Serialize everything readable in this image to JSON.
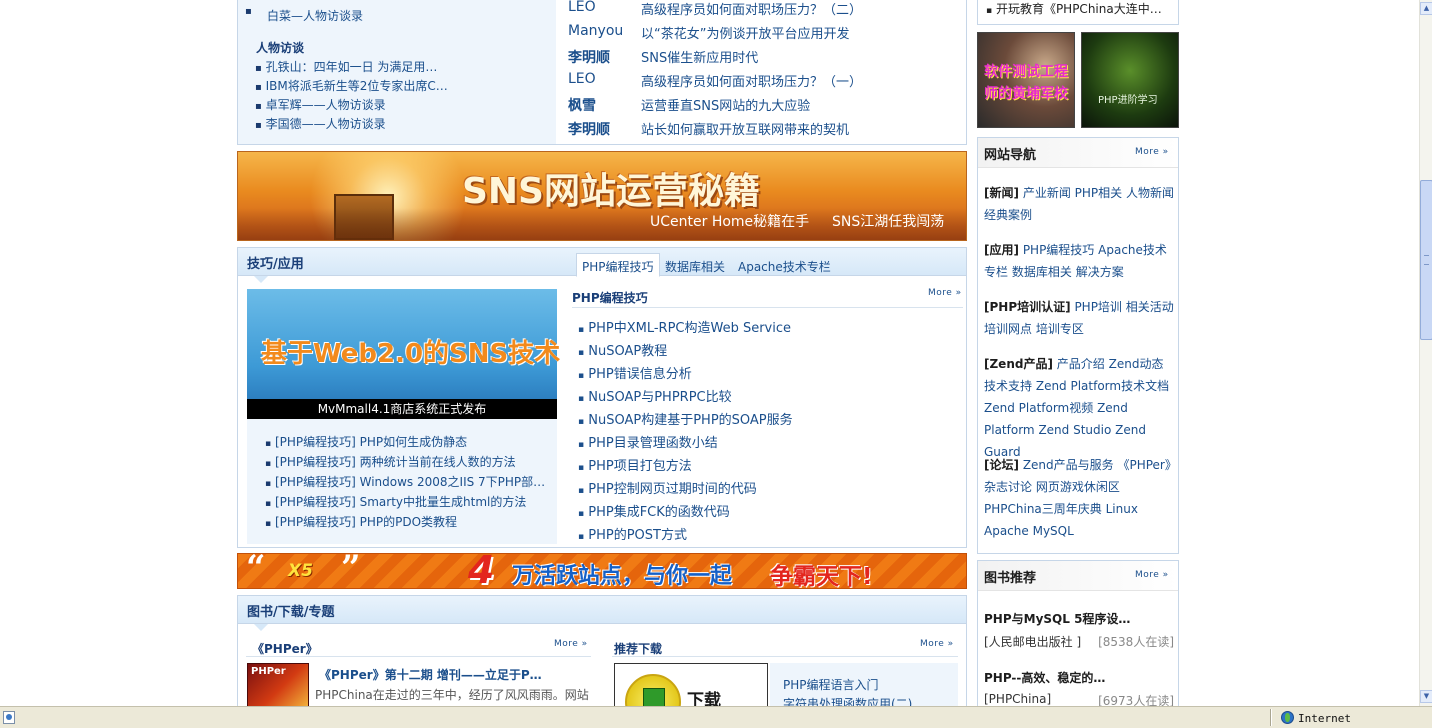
{
  "top_left": {
    "items_top": [
      "白菜—人物访谈录"
    ],
    "heading": "人物访谈",
    "items": [
      "孔铁山：四年如一日 为满足用…",
      "IBM将派毛新生等2位专家出席C…",
      "卓军辉——人物访谈录",
      "李国德——人物访谈录"
    ]
  },
  "top_mid": {
    "rows": [
      {
        "author": "LEO",
        "title": "高级程序员如何面对职场压力？（二）"
      },
      {
        "author": "Manyou",
        "title": "以“茶花女”为例谈开放平台应用开发"
      },
      {
        "author": "李明顺",
        "title": "SNS催生新应用时代"
      },
      {
        "author": "LEO",
        "title": "高级程序员如何面对职场压力？（一）"
      },
      {
        "author": "枫雪",
        "title": "运营垂直SNS网站的九大应验"
      },
      {
        "author": "李明顺",
        "title": "站长如何赢取开放互联网带来的契机"
      }
    ]
  },
  "banner_sns": {
    "title": "SNS网站运营秘籍",
    "sub1": "UCenter Home秘籍在手",
    "sub2": "SNS江湖任我闯荡"
  },
  "tips": {
    "title": "技巧/应用",
    "tabs": [
      "PHP编程技巧",
      "数据库相关",
      "Apache技术专栏"
    ],
    "feature_image_text": "基于Web2.0的SNS技术",
    "feature_caption": "MvMmall4.1商店系统正式发布",
    "left_list": [
      "[PHP编程技巧] PHP如何生成伪静态",
      "[PHP编程技巧] 两种统计当前在线人数的方法",
      "[PHP编程技巧] Windows 2008之IIS 7下PHP部…",
      "[PHP编程技巧] Smarty中批量生成html的方法",
      "[PHP编程技巧] PHP的PDO类教程"
    ],
    "list_title": "PHP编程技巧",
    "more": "More »",
    "right_list": [
      "PHP中XML-RPC构造Web Service",
      "NuSOAP教程",
      "PHP错误信息分析",
      "NuSOAP与PHPRPC比较",
      "NuSOAP构建基于PHP的SOAP服务",
      "PHP目录管理函数小结",
      "PHP项目打包方法",
      "PHP控制网页过期时间的代码",
      "PHP集成FCK的函数代码",
      "PHP的POST方式"
    ]
  },
  "banner_x5": {
    "logo": "X5",
    "number": "4",
    "text": "万活跃站点，与你一起",
    "emph": "争霸天下!"
  },
  "books_section": {
    "title": "图书/下载/专题",
    "phper_title": "《PHPer》",
    "more": "More »",
    "phper_item_title": "《PHPer》第十二期 增刊——立足于P…",
    "phper_item_desc": "PHPChina在走过的三年中，经历了风风雨雨。网站",
    "phper_cover_text": "PHPer",
    "download_title": "推荐下载",
    "download_btn": "下载",
    "download_items": [
      "PHP编程语言入门",
      "字符串处理函数应用(二)"
    ]
  },
  "sidebar": {
    "top_item": "开玩教育《PHPChina大连中…",
    "img1_text": "软件测试工程师的黄埔军校",
    "img2_text": "PHP进阶学习",
    "nav_title": "网站导航",
    "more": "More »",
    "nav_groups": [
      {
        "label": "[新闻]",
        "links": [
          "产业新闻",
          "PHP相关",
          "人物新闻",
          "经典案例"
        ]
      },
      {
        "label": "[应用]",
        "links": [
          "PHP编程技巧",
          "Apache技术专栏",
          "数据库相关",
          "解决方案"
        ]
      },
      {
        "label": "[PHP培训认证]",
        "links": [
          "PHP培训",
          "相关活动",
          "培训网点",
          "培训专区"
        ]
      },
      {
        "label": "[Zend产品]",
        "links": [
          "产品介绍",
          "Zend动态",
          "技术支持",
          "Zend Platform技术文档",
          "Zend Platform视频",
          "Zend Platform",
          "Zend Studio",
          "Zend Guard"
        ]
      },
      {
        "label": "[论坛]",
        "links": [
          "Zend产品与服务",
          "《PHPer》杂志讨论",
          "网页游戏休闲区",
          "PHPChina三周年庆典",
          "Linux",
          "Apache",
          "MySQL"
        ]
      }
    ],
    "books_title": "图书推荐",
    "books": [
      {
        "title": "PHP与MySQL 5程序设…",
        "publisher": "[人民邮电出版社 ]",
        "readers": "[8538人在读]"
      },
      {
        "title": "PHP--高效、稳定的…",
        "publisher": "[PHPChina]",
        "readers": "[6973人在读]"
      }
    ]
  },
  "statusbar": {
    "zone": "Internet"
  },
  "colors": {
    "link": "#1b4f8c",
    "section_bg": "#d6e8f8",
    "border": "#c6d6e8",
    "banner_orange": "#e8801a"
  }
}
